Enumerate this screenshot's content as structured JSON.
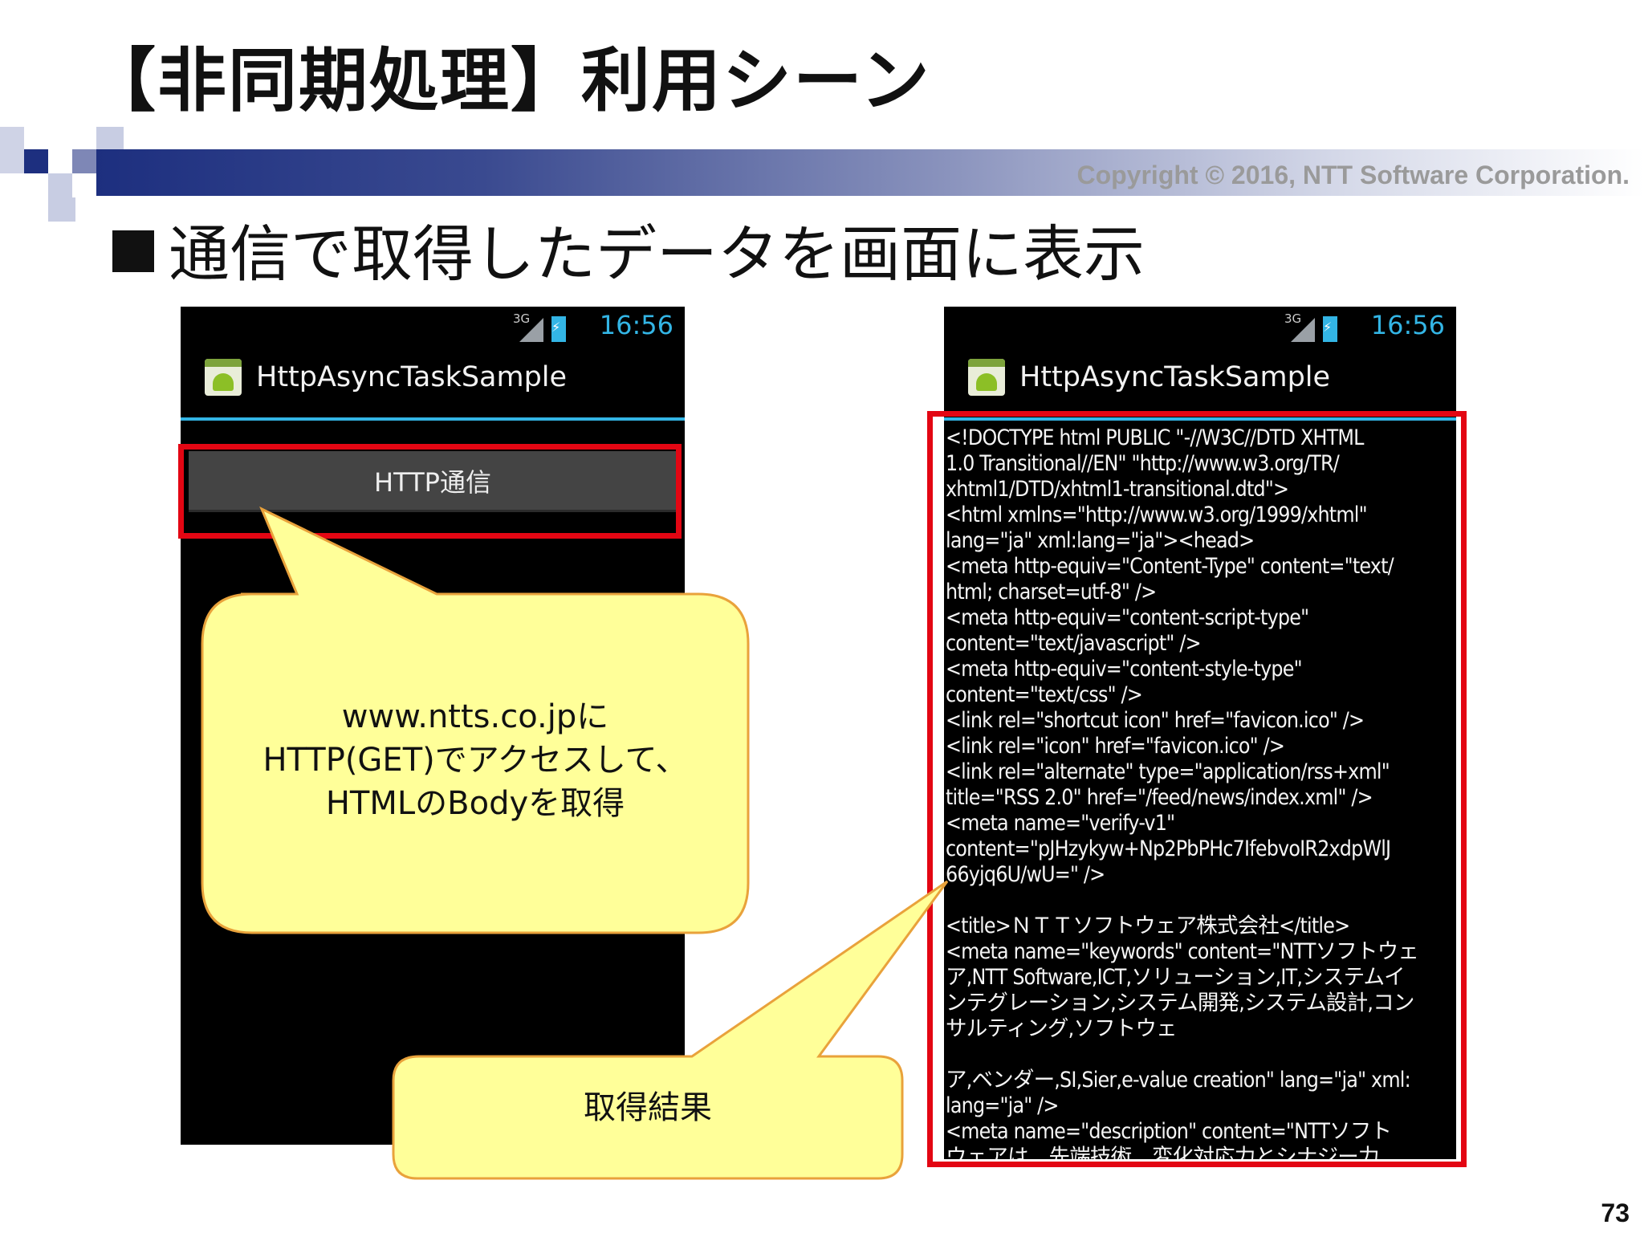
{
  "slide": {
    "title": "【非同期処理】利用シーン",
    "copyright": "Copyright © 2016, NTT Software Corporation.",
    "bullet": "通信で取得したデータを画面に表示",
    "page_number": "73"
  },
  "phone_left": {
    "status": {
      "network": "3G",
      "time": "16:56"
    },
    "app_title": "HttpAsyncTaskSample",
    "button_label": "HTTP通信"
  },
  "phone_right": {
    "status": {
      "network": "3G",
      "time": "16:56"
    },
    "app_title": "HttpAsyncTaskSample",
    "result_text": "<!DOCTYPE html PUBLIC \"-//W3C//DTD XHTML\n1.0 Transitional//EN\" \"http://www.w3.org/TR/\nxhtml1/DTD/xhtml1-transitional.dtd\">\n<html xmlns=\"http://www.w3.org/1999/xhtml\"\nlang=\"ja\" xml:lang=\"ja\"><head>\n<meta http-equiv=\"Content-Type\" content=\"text/\nhtml; charset=utf-8\" />\n<meta http-equiv=\"content-script-type\"\ncontent=\"text/javascript\" />\n<meta http-equiv=\"content-style-type\"\ncontent=\"text/css\" />\n<link rel=\"shortcut icon\" href=\"favicon.ico\" />\n<link rel=\"icon\" href=\"favicon.ico\" />\n<link rel=\"alternate\" type=\"application/rss+xml\"\ntitle=\"RSS 2.0\" href=\"/feed/news/index.xml\" />\n<meta name=\"verify-v1\"\ncontent=\"pJHzykyw+Np2PbPHc7IfebvoIR2xdpWlJ\n66yjq6U/wU=\" />\n\n<title>ＮＴＴソフトウェア株式会社</title>\n<meta name=\"keywords\" content=\"NTTソフトウェ\nア,NTT Software,ICT,ソリューション,IT,システムイ\nンテグレーション,システム開発,システム設計,コン\nサルティング,ソフトウェ\n\nア,ベンダー,SI,Sier,e-value creation\" lang=\"ja\" xml:\nlang=\"ja\" />\n<meta name=\"description\" content=\"NTTソフト\nウェアは、先端技術、変化対応力とシナジー力"
  },
  "callouts": {
    "request": "www.ntts.co.jpに\nHTTP(GET)でアクセスして、\nHTMLのBodyを取得",
    "result": "取得結果"
  },
  "colors": {
    "accent_blue": "#33b5e5",
    "highlight_red": "#e30613",
    "callout_fill": "#ffff99",
    "callout_stroke": "#e9a23b",
    "header_band": "#1d2f7f"
  }
}
